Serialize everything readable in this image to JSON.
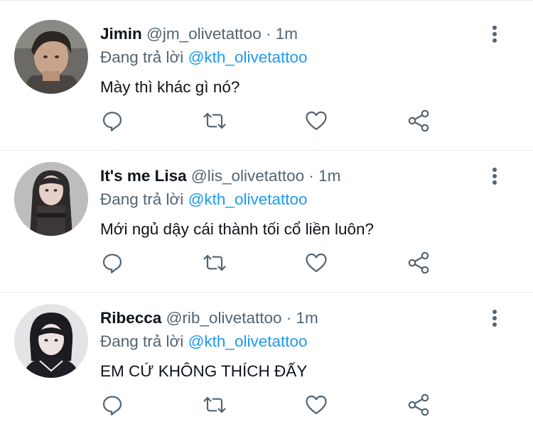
{
  "colors": {
    "text": "#0f1419",
    "secondary": "#536471",
    "mention": "#1d9bf0",
    "divider": "#e6e9ec"
  },
  "tweets": [
    {
      "name": "Jimin",
      "handle": "@jm_olivetattoo",
      "dot": "·",
      "time": "1m",
      "reply_prefix": "Đang trả lời",
      "reply_to": "@kth_olivetattoo",
      "text": "Mày thì khác gì nó?",
      "icons": [
        "reply-icon",
        "retweet-icon",
        "like-icon",
        "share-icon",
        "more-icon"
      ]
    },
    {
      "name": "It's me Lisa",
      "handle": "@lis_olivetattoo",
      "dot": "·",
      "time": "1m",
      "reply_prefix": "Đang trả lời",
      "reply_to": "@kth_olivetattoo",
      "text": "Mới ngủ dậy cái thành tối cổ liền luôn?",
      "icons": [
        "reply-icon",
        "retweet-icon",
        "like-icon",
        "share-icon",
        "more-icon"
      ]
    },
    {
      "name": "Ribecca",
      "handle": "@rib_olivetattoo",
      "dot": "·",
      "time": "1m",
      "reply_prefix": "Đang trả lời",
      "reply_to": "@kth_olivetattoo",
      "text": "EM CỨ KHÔNG THÍCH ĐẤY",
      "icons": [
        "reply-icon",
        "retweet-icon",
        "like-icon",
        "share-icon",
        "more-icon"
      ]
    }
  ]
}
